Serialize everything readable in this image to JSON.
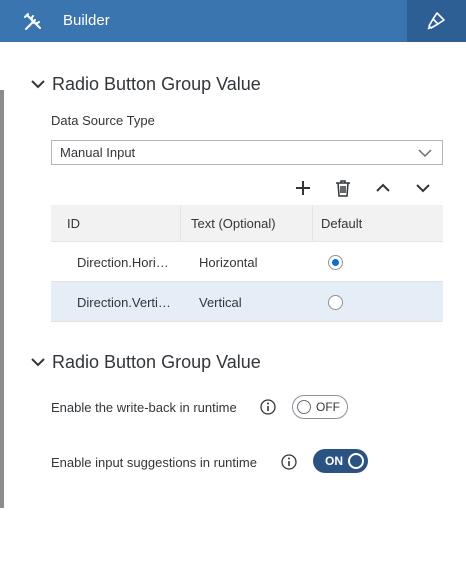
{
  "header": {
    "title": "Builder",
    "tools_icon": "tools-icon",
    "styling_icon": "paintbrush-icon",
    "accent": "#3a75b0"
  },
  "section1": {
    "title": "Radio Button Group Value",
    "data_source_label": "Data Source Type",
    "data_source_value": "Manual Input"
  },
  "toolbar": {
    "add_icon": "plus-icon",
    "delete_icon": "trash-icon",
    "up_icon": "chevron-up-icon",
    "down_icon": "chevron-down-icon"
  },
  "table": {
    "columns": [
      "ID",
      "Text (Optional)",
      "Default"
    ],
    "rows": [
      {
        "id": "Direction.Hori…",
        "text": "Horizontal",
        "default": true
      },
      {
        "id": "Direction.Verti…",
        "text": "Vertical",
        "default": false
      }
    ]
  },
  "section2": {
    "title": "Radio Button Group Value",
    "writeback_label": "Enable the write-back in runtime",
    "writeback_state": "OFF",
    "suggestions_label": "Enable input suggestions in runtime",
    "suggestions_state": "ON"
  }
}
